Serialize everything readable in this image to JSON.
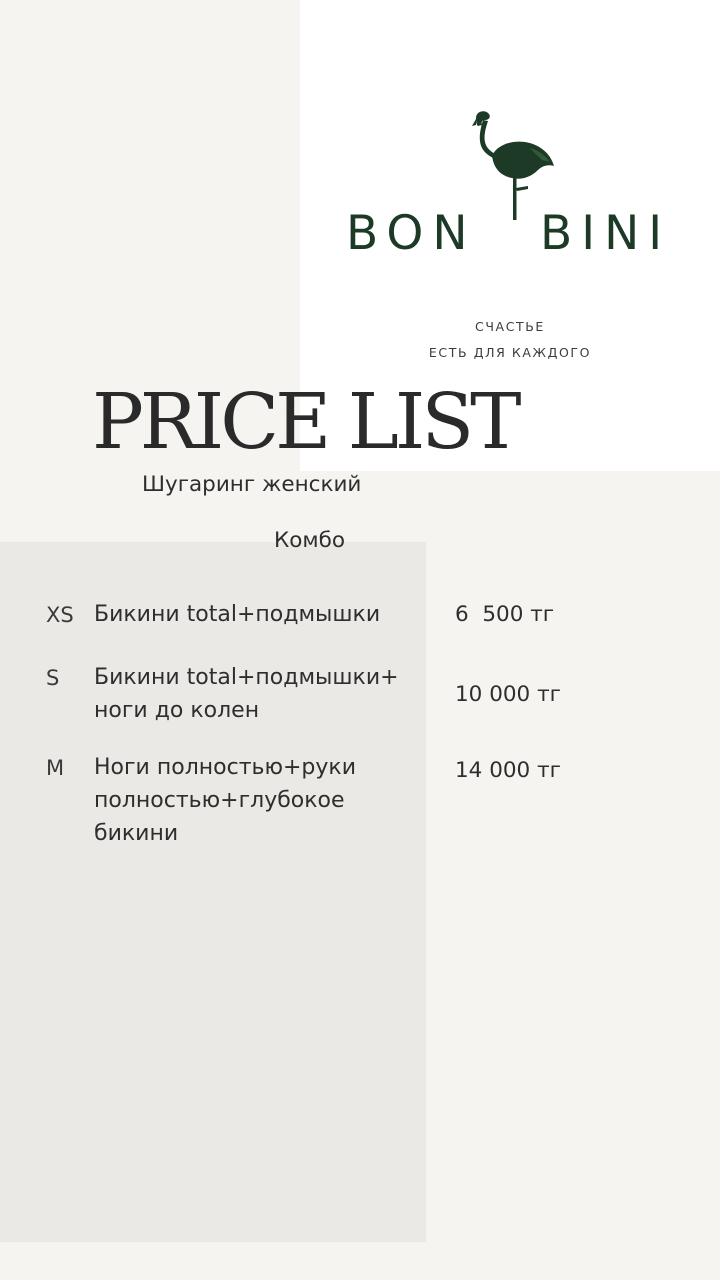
{
  "brand": {
    "left": "BON",
    "right": "BINI",
    "tagline_line1": "СЧАСТЬЕ",
    "tagline_line2": "ЕСТЬ ДЛЯ КАЖДОГО",
    "logo_icon": "flamingo-icon",
    "color": "#1d3a26"
  },
  "title": "PRICE LIST",
  "subtitle": "Шугаринг женский",
  "section_title": "Комбо",
  "items": [
    {
      "size": "XS",
      "description": "Бикини total+подмышки",
      "price": "6  500 тг"
    },
    {
      "size": "S",
      "description": "Бикини total+подмышки+ ноги до колен",
      "price": "10 000 тг"
    },
    {
      "size": "M",
      "description": "Ноги полностью+руки полностью+глубокое бикини",
      "price": "14 000 тг"
    }
  ]
}
